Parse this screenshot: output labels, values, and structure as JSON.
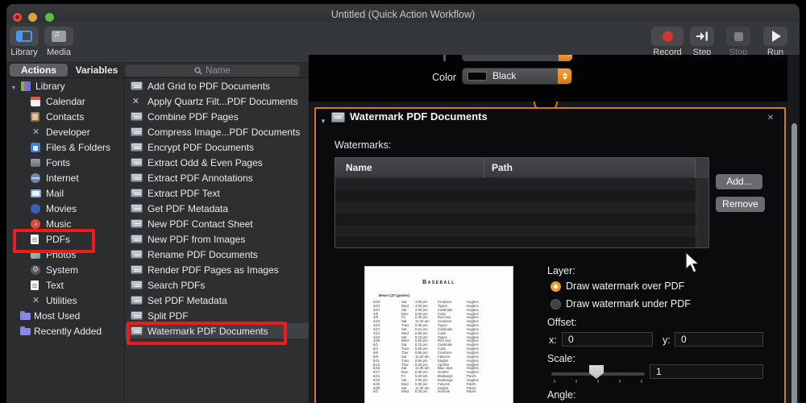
{
  "window": {
    "title": "Untitled (Quick Action Workflow)"
  },
  "toolbar": {
    "library_label": "Library",
    "media_label": "Media",
    "record_label": "Record",
    "step_label": "Step",
    "stop_label": "Stop",
    "run_label": "Run"
  },
  "tabs": {
    "actions_label": "Actions",
    "variables_label": "Variables",
    "search_placeholder": "Name"
  },
  "sidebar": {
    "items": [
      {
        "label": "Library",
        "icon": "library",
        "level": 0,
        "expandable": true
      },
      {
        "label": "Calendar",
        "icon": "calendar",
        "level": 1
      },
      {
        "label": "Contacts",
        "icon": "contacts",
        "level": 1
      },
      {
        "label": "Developer",
        "icon": "developer",
        "level": 1
      },
      {
        "label": "Files & Folders",
        "icon": "files-folders",
        "level": 1
      },
      {
        "label": "Fonts",
        "icon": "fonts",
        "level": 1
      },
      {
        "label": "Internet",
        "icon": "internet",
        "level": 1
      },
      {
        "label": "Mail",
        "icon": "mail",
        "level": 1
      },
      {
        "label": "Movies",
        "icon": "movies",
        "level": 1
      },
      {
        "label": "Music",
        "icon": "music",
        "level": 1
      },
      {
        "label": "PDFs",
        "icon": "pdfs",
        "level": 1,
        "annotated": true
      },
      {
        "label": "Photos",
        "icon": "photos",
        "level": 1
      },
      {
        "label": "System",
        "icon": "system",
        "level": 1
      },
      {
        "label": "Text",
        "icon": "text",
        "level": 1
      },
      {
        "label": "Utilities",
        "icon": "utilities",
        "level": 1
      },
      {
        "label": "Most Used",
        "icon": "folder",
        "level": 0
      },
      {
        "label": "Recently Added",
        "icon": "folder",
        "level": 0
      }
    ]
  },
  "action_list": {
    "items": [
      {
        "label": "Add Grid to PDF Documents",
        "icon": "action"
      },
      {
        "label": "Apply Quartz Filt...PDF Documents",
        "icon": "quartz"
      },
      {
        "label": "Combine PDF Pages",
        "icon": "action"
      },
      {
        "label": "Compress Image...PDF Documents",
        "icon": "action"
      },
      {
        "label": "Encrypt PDF Documents",
        "icon": "action"
      },
      {
        "label": "Extract Odd & Even Pages",
        "icon": "action"
      },
      {
        "label": "Extract PDF Annotations",
        "icon": "action"
      },
      {
        "label": "Extract PDF Text",
        "icon": "action"
      },
      {
        "label": "Get PDF Metadata",
        "icon": "action"
      },
      {
        "label": "New PDF Contact Sheet",
        "icon": "action"
      },
      {
        "label": "New PDF from Images",
        "icon": "action"
      },
      {
        "label": "Rename PDF Documents",
        "icon": "action"
      },
      {
        "label": "Render PDF Pages as Images",
        "icon": "action"
      },
      {
        "label": "Search PDFs",
        "icon": "action"
      },
      {
        "label": "Set PDF Metadata",
        "icon": "action"
      },
      {
        "label": "Split PDF",
        "icon": "action"
      },
      {
        "label": "Watermark PDF Documents",
        "icon": "action",
        "selected": true,
        "annotated": true
      }
    ]
  },
  "previous_action": {
    "color_label": "Color",
    "color_value": "Black"
  },
  "watermark_action": {
    "title": "Watermark PDF Documents",
    "watermarks_label": "Watermarks:",
    "table": {
      "columns": {
        "name": "Name",
        "path": "Path"
      },
      "rows": []
    },
    "add_label": "Add...",
    "remove_label": "Remove",
    "layer": {
      "label": "Layer:",
      "option_over": "Draw watermark over PDF",
      "option_under": "Draw watermark under PDF",
      "selected": "Draw watermark over PDF"
    },
    "offset": {
      "label": "Offset:",
      "x_label": "x:",
      "x_value": "0",
      "y_label": "y:",
      "y_value": "0"
    },
    "scale": {
      "label": "Scale:",
      "value": "1"
    },
    "angle": {
      "label": "Angle:"
    }
  },
  "preview_document": {
    "title": "Baseball",
    "subtitle": "Bears (27 games)",
    "rows": [
      {
        "d": "3/23",
        "w": "Sat",
        "t": "4:00 pm",
        "o": "Crushers",
        "l": "Hughes"
      },
      {
        "d": "3/24",
        "w": "Wed",
        "t": "4:00 pm",
        "o": "Tigers",
        "l": "Hughes"
      },
      {
        "d": "3/27",
        "w": "Sat",
        "t": "2:00 pm",
        "o": "Cardinals",
        "l": "Hughes"
      },
      {
        "d": "4/5",
        "w": "Mon",
        "t": "5:00 pm",
        "o": "Cubs",
        "l": "Hughes"
      },
      {
        "d": "4/9",
        "w": "Fri",
        "t": "5:30 pm",
        "o": "Red Sox",
        "l": "Hughes"
      },
      {
        "d": "4/10",
        "w": "Sat",
        "t": "11:40 am",
        "o": "Crushers",
        "l": "Hughes"
      },
      {
        "d": "4/13",
        "w": "Tues",
        "t": "5:30 pm",
        "o": "Tigers",
        "l": "Hughes"
      },
      {
        "d": "4/17",
        "w": "Sat",
        "t": "5:15 pm",
        "o": "Cardinals",
        "l": "Hughes"
      },
      {
        "d": "4/21",
        "w": "Wed",
        "t": "5:55 pm",
        "o": "Cubs",
        "l": "Hughes"
      },
      {
        "d": "4/24",
        "w": "Sat",
        "t": "5:15 pm",
        "o": "Tigers",
        "l": "Hughes"
      },
      {
        "d": "4/28",
        "w": "Wed",
        "t": "5:55 pm",
        "o": "Red Sox",
        "l": "Hughes"
      },
      {
        "d": "5/1",
        "w": "Sat",
        "t": "5:15 pm",
        "o": "Cardinals",
        "l": "Hughes"
      },
      {
        "d": "5/4",
        "w": "Tues",
        "t": "5:55 pm",
        "o": "Cubs",
        "l": "Hughes"
      },
      {
        "d": "5/6",
        "w": "Thur",
        "t": "5:55 pm",
        "o": "Crushers",
        "l": "Hughes"
      },
      {
        "d": "5/8",
        "w": "Sat",
        "t": "11:40 am",
        "o": "Falcons",
        "l": "Hughes"
      },
      {
        "d": "5/11",
        "w": "Tues",
        "t": "5:55 pm",
        "o": "Eagles",
        "l": "Hughes"
      },
      {
        "d": "5/13",
        "w": "Thur",
        "t": "5:30 pm",
        "o": "Apollos",
        "l": "Hughes"
      },
      {
        "d": "5/15",
        "w": "Sat",
        "t": "11:45 am",
        "o": "Blue Jays",
        "l": "Hughes"
      },
      {
        "d": "5/17",
        "w": "Mon",
        "t": "5:30 pm",
        "o": "Orioles",
        "l": "Hughes"
      },
      {
        "d": "5/21",
        "w": "Fri",
        "t": "5:30 pm",
        "o": "Mustangs",
        "l": "Paul's"
      },
      {
        "d": "5/22",
        "w": "Sat",
        "t": "2:00 pm",
        "o": "Mustangs",
        "l": "Hughes"
      },
      {
        "d": "5/26",
        "w": "Wed",
        "t": "5:30 pm",
        "o": "Falcons",
        "l": "Paul's"
      },
      {
        "d": "5/29",
        "w": "Sat",
        "t": "11:45 am",
        "o": "Eagles",
        "l": "Paul's"
      },
      {
        "d": "6/2",
        "w": "Wed",
        "t": "5:30 pm",
        "o": "Hornets",
        "l": "Paul's"
      }
    ]
  },
  "colors": {
    "accent_orange": "#d6791c",
    "annotation_red": "#ed1c1c",
    "record_red": "#d1352b",
    "selection_gray": "#3f4245"
  }
}
